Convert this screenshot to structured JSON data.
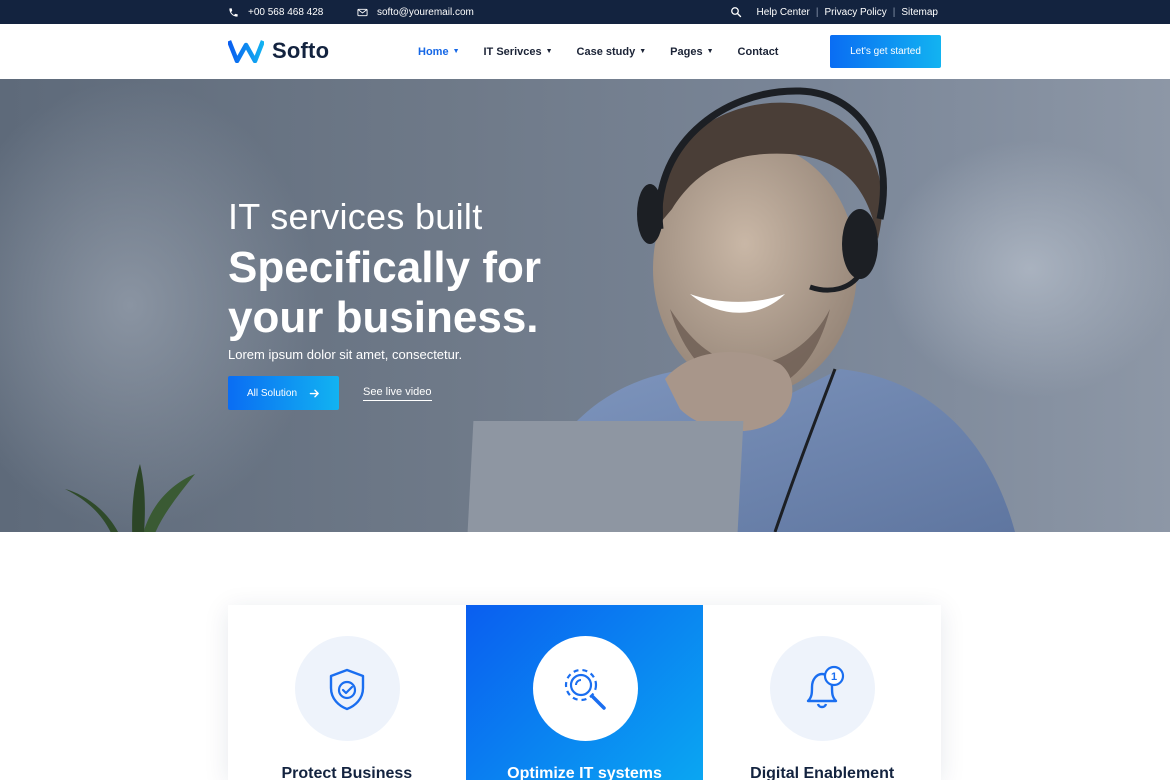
{
  "topbar": {
    "phone": "+00 568 468 428",
    "email": "softo@youremail.com",
    "links": [
      "Help Center",
      "Privacy Policy",
      "Sitemap"
    ],
    "separator": "|"
  },
  "nav": {
    "logo": "Softo",
    "items": [
      {
        "label": "Home",
        "has_dropdown": true,
        "active": true
      },
      {
        "label": "IT Serivces",
        "has_dropdown": true
      },
      {
        "label": "Case study",
        "has_dropdown": true
      },
      {
        "label": "Pages",
        "has_dropdown": true
      },
      {
        "label": "Contact",
        "has_dropdown": false
      }
    ],
    "cta": "Let's get started"
  },
  "hero": {
    "line1": "IT services built",
    "line2": "Specifically for your business.",
    "subtitle": "Lorem ipsum dolor sit amet, consectetur.",
    "primary_button": "All Solution",
    "video_link": "See live video"
  },
  "services": [
    {
      "title": "Protect Business",
      "icon": "shield-check-icon"
    },
    {
      "title": "Optimize IT systems",
      "icon": "gear-search-icon",
      "featured": true
    },
    {
      "title": "Digital Enablement",
      "icon": "bell-notification-icon",
      "badge": "1"
    }
  ],
  "colors": {
    "topbar": "#13233f",
    "accent": "#1567e6",
    "gradient_start": "#0a6df3",
    "gradient_end": "#12b3f1"
  }
}
